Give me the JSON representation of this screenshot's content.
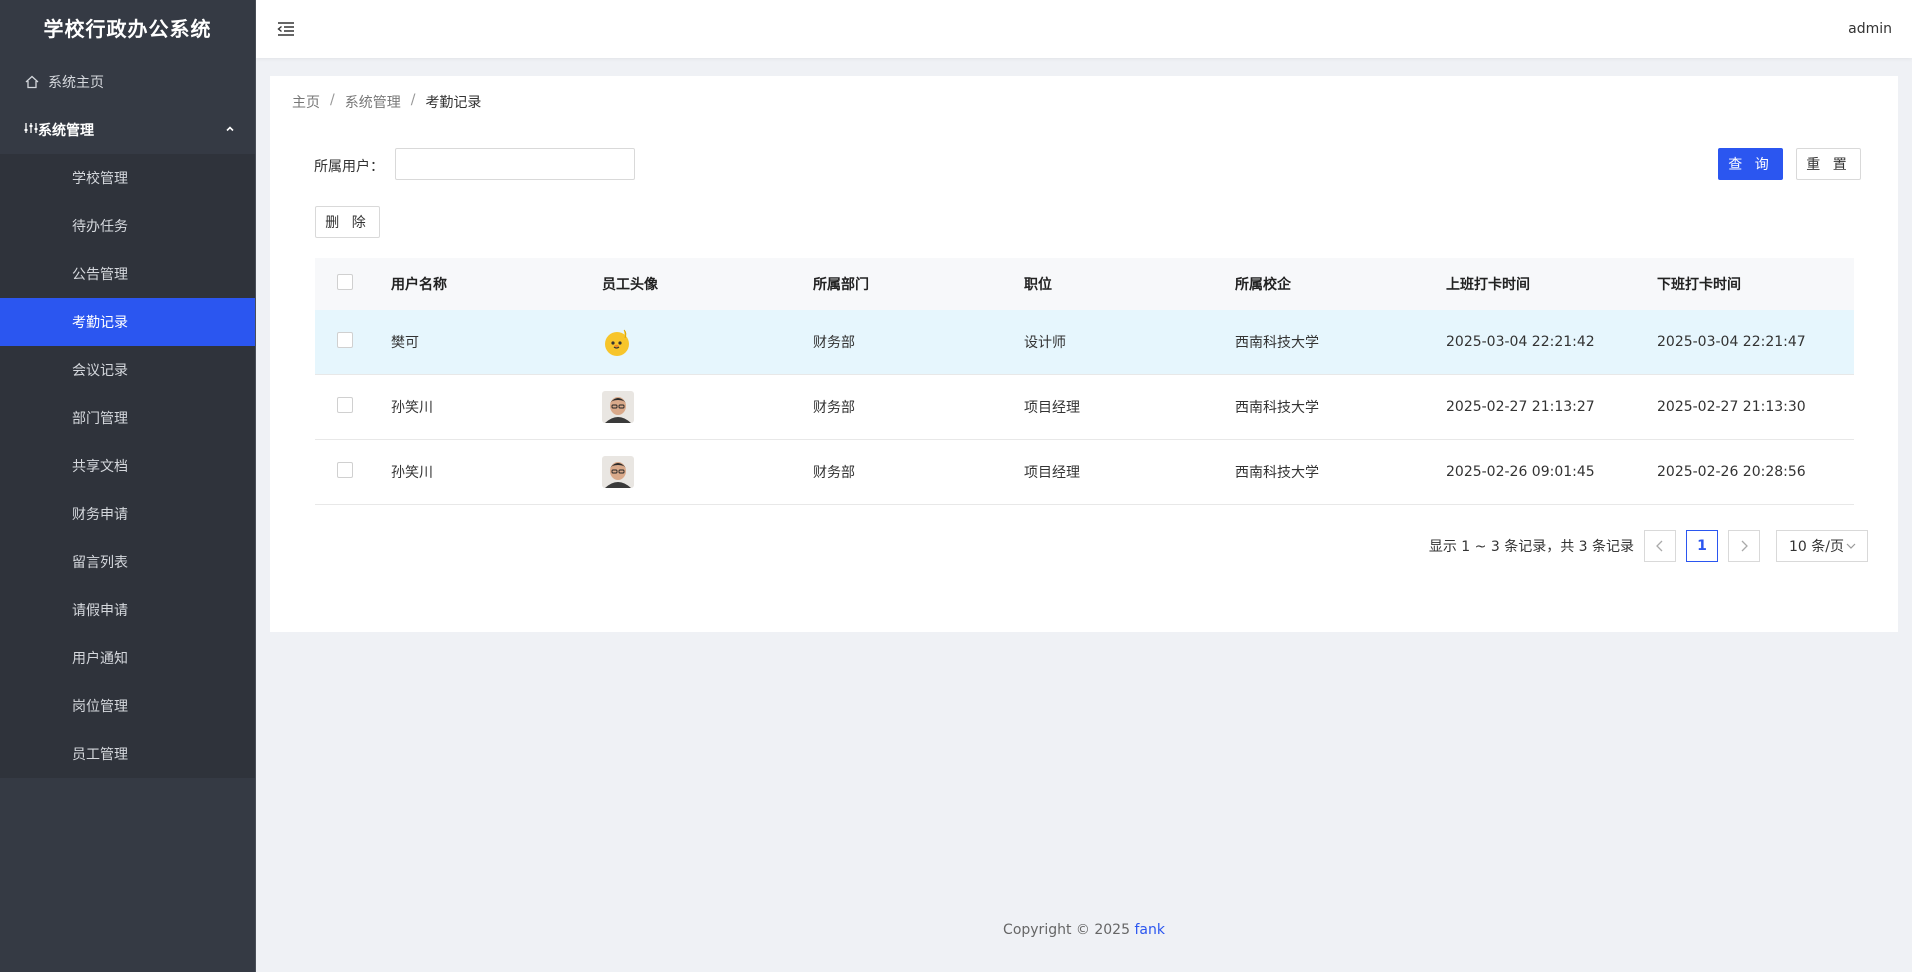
{
  "app": {
    "title": "学校行政办公系统"
  },
  "sidebar": {
    "home": {
      "label": "系统主页",
      "icon": "home-icon"
    },
    "group": {
      "label": "系统管理",
      "icon": "settings-sliders-icon"
    },
    "items": [
      {
        "label": "学校管理"
      },
      {
        "label": "待办任务"
      },
      {
        "label": "公告管理"
      },
      {
        "label": "考勤记录",
        "active": true
      },
      {
        "label": "会议记录"
      },
      {
        "label": "部门管理"
      },
      {
        "label": "共享文档"
      },
      {
        "label": "财务申请"
      },
      {
        "label": "留言列表"
      },
      {
        "label": "请假申请"
      },
      {
        "label": "用户通知"
      },
      {
        "label": "岗位管理"
      },
      {
        "label": "员工管理"
      }
    ]
  },
  "header": {
    "user": "admin"
  },
  "breadcrumb": {
    "home": "主页",
    "parent": "系统管理",
    "current": "考勤记录",
    "sep": "/"
  },
  "filter": {
    "label": "所属用户：",
    "value": "",
    "placeholder": ""
  },
  "buttons": {
    "query": "查 询",
    "reset": "重 置",
    "delete": "删 除"
  },
  "table": {
    "columns": [
      "用户名称",
      "员工头像",
      "所属部门",
      "职位",
      "所属校企",
      "上班打卡时间",
      "下班打卡时间"
    ],
    "rows": [
      {
        "name": "樊可",
        "avatar": "cartoon-chick-avatar",
        "dept": "财务部",
        "position": "设计师",
        "school": "西南科技大学",
        "checkin": "2025-03-04 22:21:42",
        "checkout": "2025-03-04 22:21:47"
      },
      {
        "name": "孙笑川",
        "avatar": "person-photo-avatar",
        "dept": "财务部",
        "position": "项目经理",
        "school": "西南科技大学",
        "checkin": "2025-02-27 21:13:27",
        "checkout": "2025-02-27 21:13:30"
      },
      {
        "name": "孙笑川",
        "avatar": "person-photo-avatar",
        "dept": "财务部",
        "position": "项目经理",
        "school": "西南科技大学",
        "checkin": "2025-02-26 09:01:45",
        "checkout": "2025-02-26 20:28:56"
      }
    ]
  },
  "pagination": {
    "summary": "显示 1 ~ 3 条记录，共 3 条记录",
    "current": "1",
    "page_size": "10 条/页"
  },
  "footer": {
    "copyright": "Copyright © 2025",
    "author": "fank"
  },
  "colors": {
    "accent": "#2b56f0",
    "sidebar_bg": "#353a44",
    "highlight_row": "#e6f6fd"
  }
}
